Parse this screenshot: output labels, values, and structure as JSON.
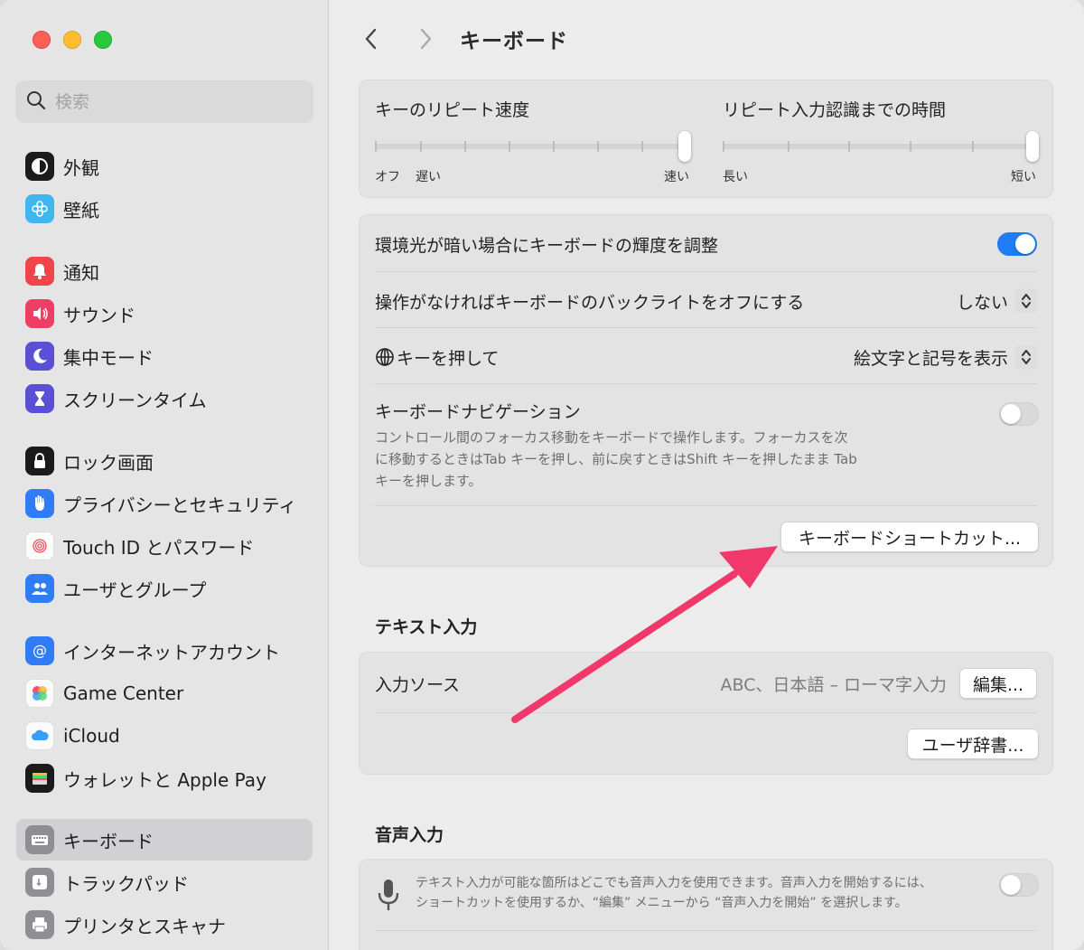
{
  "sidebar": {
    "search_placeholder": "検索",
    "items": [
      {
        "label": "外観"
      },
      {
        "label": "壁紙"
      },
      {
        "label": "通知"
      },
      {
        "label": "サウンド"
      },
      {
        "label": "集中モード"
      },
      {
        "label": "スクリーンタイム"
      },
      {
        "label": "ロック画面"
      },
      {
        "label": "プライバシーとセキュリティ"
      },
      {
        "label": "Touch ID とパスワード"
      },
      {
        "label": "ユーザとグループ"
      },
      {
        "label": "インターネットアカウント"
      },
      {
        "label": "Game Center"
      },
      {
        "label": "iCloud"
      },
      {
        "label": "ウォレットと Apple Pay"
      },
      {
        "label": "キーボード"
      },
      {
        "label": "トラックパッド"
      },
      {
        "label": "プリンタとスキャナ"
      }
    ]
  },
  "header": {
    "title": "キーボード"
  },
  "repeat": {
    "speed_label": "キーのリピート速度",
    "speed_min_label": "オフ",
    "speed_slow_label": "遅い",
    "speed_max_label": "速い",
    "speed_value": 1.0,
    "delay_label": "リピート入力認識までの時間",
    "delay_min_label": "長い",
    "delay_max_label": "短い",
    "delay_value": 1.0
  },
  "settings": {
    "brightness_label": "環境光が暗い場合にキーボードの輝度を調整",
    "brightness_on": true,
    "backlight_label": "操作がなければキーボードのバックライトをオフにする",
    "backlight_value": "しない",
    "globe_label": "キーを押して",
    "globe_value": "絵文字と記号を表示",
    "nav_label": "キーボードナビゲーション",
    "nav_desc_1": "コントロール間のフォーカス移動をキーボードで操作します。フォーカスを次",
    "nav_desc_2": "に移動するときはTab キーを押し、前に戻すときはShift キーを押したまま Tab",
    "nav_desc_3": "キーを押します。",
    "nav_on": false,
    "shortcuts_button": "キーボードショートカット..."
  },
  "text_input": {
    "section_title": "テキスト入力",
    "source_label": "入力ソース",
    "source_value": "ABC、日本語 – ローマ字入力",
    "edit_button": "編集...",
    "dictionary_button": "ユーザ辞書..."
  },
  "dictation": {
    "section_title": "音声入力",
    "desc_1": "テキスト入力が可能な箇所はどこでも音声入力を使用できます。音声入力を開始するには、",
    "desc_2": "ショートカットを使用するか、“編集” メニューから “音声入力を開始” を選択します。",
    "on": false
  },
  "colors": {
    "accent": "#1f7cf6",
    "annotation_arrow": "#f0386b"
  }
}
